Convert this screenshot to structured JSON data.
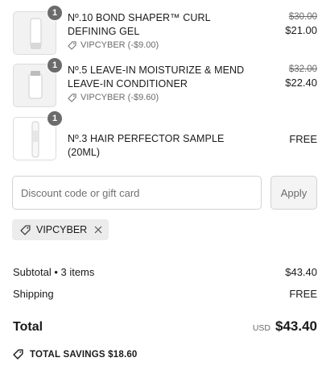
{
  "items": [
    {
      "quantity": "1",
      "title": "Nº.10 BOND SHAPER™ CURL DEFINING GEL",
      "discount_label": "VIPCYBER (-$9.00)",
      "original_price": "$30.00",
      "price": "$21.00"
    },
    {
      "quantity": "1",
      "title": "Nº.5 LEAVE-IN MOISTURIZE & MEND LEAVE-IN CONDITIONER",
      "discount_label": "VIPCYBER (-$9.60)",
      "original_price": "$32.00",
      "price": "$22.40"
    },
    {
      "quantity": "1",
      "title": "Nº.3 HAIR PERFECTOR SAMPLE (20mL)",
      "price": "FREE"
    }
  ],
  "discount": {
    "placeholder": "Discount code or gift card",
    "apply_label": "Apply",
    "applied_code": "VIPCYBER"
  },
  "summary": {
    "subtotal_label": "Subtotal • 3 items",
    "subtotal_value": "$43.40",
    "shipping_label": "Shipping",
    "shipping_value": "FREE",
    "total_label": "Total",
    "currency": "USD",
    "total_value": "$43.40",
    "savings_text": "TOTAL SAVINGS $18.60"
  },
  "icons": {
    "tag": "tag-icon",
    "remove": "close-icon"
  }
}
